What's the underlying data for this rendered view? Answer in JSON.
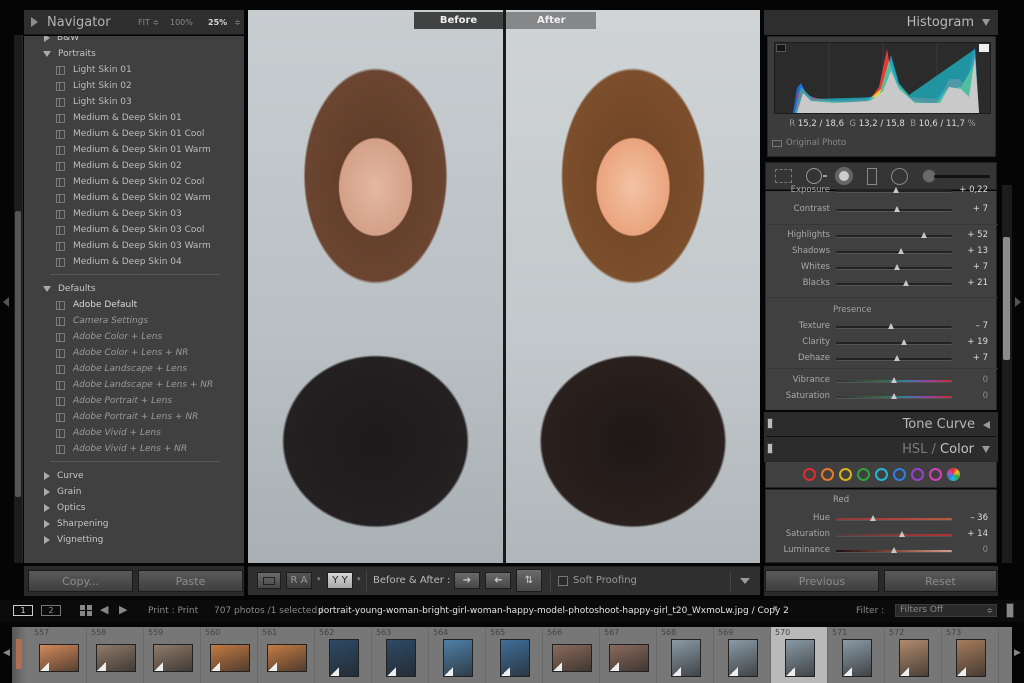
{
  "navigator": {
    "title": "Navigator",
    "fit": "FIT ≑",
    "zoom100": "100%",
    "zoom_current": "25%",
    "zoom_menu": "≑"
  },
  "presets": {
    "groups": [
      {
        "label": "B&W",
        "expanded": false
      },
      {
        "label": "Portraits",
        "expanded": true
      },
      {
        "label": "Defaults",
        "expanded": true
      },
      {
        "label": "Curve",
        "expanded": false
      },
      {
        "label": "Grain",
        "expanded": false
      },
      {
        "label": "Optics",
        "expanded": false
      },
      {
        "label": "Sharpening",
        "expanded": false
      },
      {
        "label": "Vignetting",
        "expanded": false
      }
    ],
    "portraits": [
      "Light Skin 01",
      "Light Skin 02",
      "Light Skin 03",
      "Medium & Deep Skin 01",
      "Medium & Deep Skin 01 Cool",
      "Medium & Deep Skin 01 Warm",
      "Medium & Deep Skin 02",
      "Medium & Deep Skin 02 Cool",
      "Medium & Deep Skin 02 Warm",
      "Medium & Deep Skin 03",
      "Medium & Deep Skin 03 Cool",
      "Medium & Deep Skin 03 Warm",
      "Medium & Deep Skin 04"
    ],
    "defaults": [
      "Adobe Default",
      "Camera Settings",
      "Adobe Color + Lens",
      "Adobe Color + Lens + NR",
      "Adobe Landscape + Lens",
      "Adobe Landscape + Lens + NR",
      "Adobe Portrait + Lens",
      "Adobe Portrait + Lens + NR",
      "Adobe Vivid + Lens",
      "Adobe Vivid + Lens + NR"
    ]
  },
  "left_buttons": {
    "copy": "Copy...",
    "paste": "Paste"
  },
  "view": {
    "before_label": "Before",
    "after_label": "After"
  },
  "toolbar": {
    "ra_label": "R A",
    "yy_label": "Y Y",
    "before_after_label": "Before & After :",
    "soft_proofing_label": "Soft Proofing",
    "soft_proofing_checked": false
  },
  "histogram": {
    "title": "Histogram",
    "r_label": "R",
    "r_value": "15,2 / 18,6",
    "g_label": "G",
    "g_value": "13,2 / 15,8",
    "b_label": "B",
    "b_value": "10,6 /  11,7",
    "unit": "%",
    "original_photo_label": "Original Photo"
  },
  "basic": {
    "exposure": {
      "label": "Exposure",
      "value": "+ 0,22",
      "pos": 0.52
    },
    "sliders": [
      {
        "label": "Contrast",
        "value": "+ 7",
        "pos": 0.53
      },
      {
        "label": "Highlights",
        "value": "+ 52",
        "pos": 0.76
      },
      {
        "label": "Shadows",
        "value": "+ 13",
        "pos": 0.56
      },
      {
        "label": "Whites",
        "value": "+ 7",
        "pos": 0.53
      },
      {
        "label": "Blacks",
        "value": "+ 21",
        "pos": 0.6
      }
    ],
    "presence_label": "Presence",
    "presence": [
      {
        "label": "Texture",
        "value": "– 7",
        "pos": 0.47
      },
      {
        "label": "Clarity",
        "value": "+ 19",
        "pos": 0.59
      },
      {
        "label": "Dehaze",
        "value": "+ 7",
        "pos": 0.53
      }
    ],
    "color": [
      {
        "label": "Vibrance",
        "value": "0",
        "pos": 0.5
      },
      {
        "label": "Saturation",
        "value": "0",
        "pos": 0.5
      }
    ]
  },
  "tone_curve": {
    "title": "Tone Curve"
  },
  "hsl": {
    "title_hsl": "HSL",
    "title_sep": "/",
    "title_color": "Color",
    "swatches": [
      "#e02d2d",
      "#e8782a",
      "#d8b21e",
      "#2ea33c",
      "#25b7cf",
      "#2f7fe0",
      "#9a3fcf",
      "#d63fb8"
    ],
    "active_color": "Red",
    "sliders": [
      {
        "label": "Hue",
        "value": "– 36",
        "pos": 0.32
      },
      {
        "label": "Saturation",
        "value": "+ 14",
        "pos": 0.57
      },
      {
        "label": "Luminance",
        "value": "0",
        "pos": 0.5
      }
    ]
  },
  "right_buttons": {
    "previous": "Previous",
    "reset": "Reset"
  },
  "filmstrip_bar": {
    "screen1": "1",
    "screen2": "2",
    "module": "Print : Print",
    "count": "707 photos /1 selected /",
    "filename": "portrait-young-woman-bright-girl-woman-happy-model-photoshoot-happy-girl_t20_WxmoLw.jpg / Copy 2",
    "filter_label": "Filter :",
    "filter_value": "Filters Off"
  },
  "filmstrip": [
    {
      "num": "557",
      "tone": "#d58a5a"
    },
    {
      "num": "558",
      "tone": "#8f7a6a"
    },
    {
      "num": "559",
      "tone": "#8f7a6a"
    },
    {
      "num": "560",
      "tone": "#c57b45"
    },
    {
      "num": "561",
      "tone": "#c57b45"
    },
    {
      "num": "562",
      "tone": "#2d4a66"
    },
    {
      "num": "563",
      "tone": "#2d4a66"
    },
    {
      "num": "564",
      "tone": "#4f7fa8"
    },
    {
      "num": "565",
      "tone": "#3f6e98"
    },
    {
      "num": "566",
      "tone": "#8b6a5c"
    },
    {
      "num": "567",
      "tone": "#8b6a5c"
    },
    {
      "num": "568",
      "tone": "#8a9aa6"
    },
    {
      "num": "569",
      "tone": "#8a9aa6"
    },
    {
      "num": "570",
      "tone": "#8a9aa6",
      "selected": true
    },
    {
      "num": "571",
      "tone": "#8a9aa6"
    },
    {
      "num": "572",
      "tone": "#b08a6c"
    },
    {
      "num": "573",
      "tone": "#a67c5c"
    }
  ]
}
